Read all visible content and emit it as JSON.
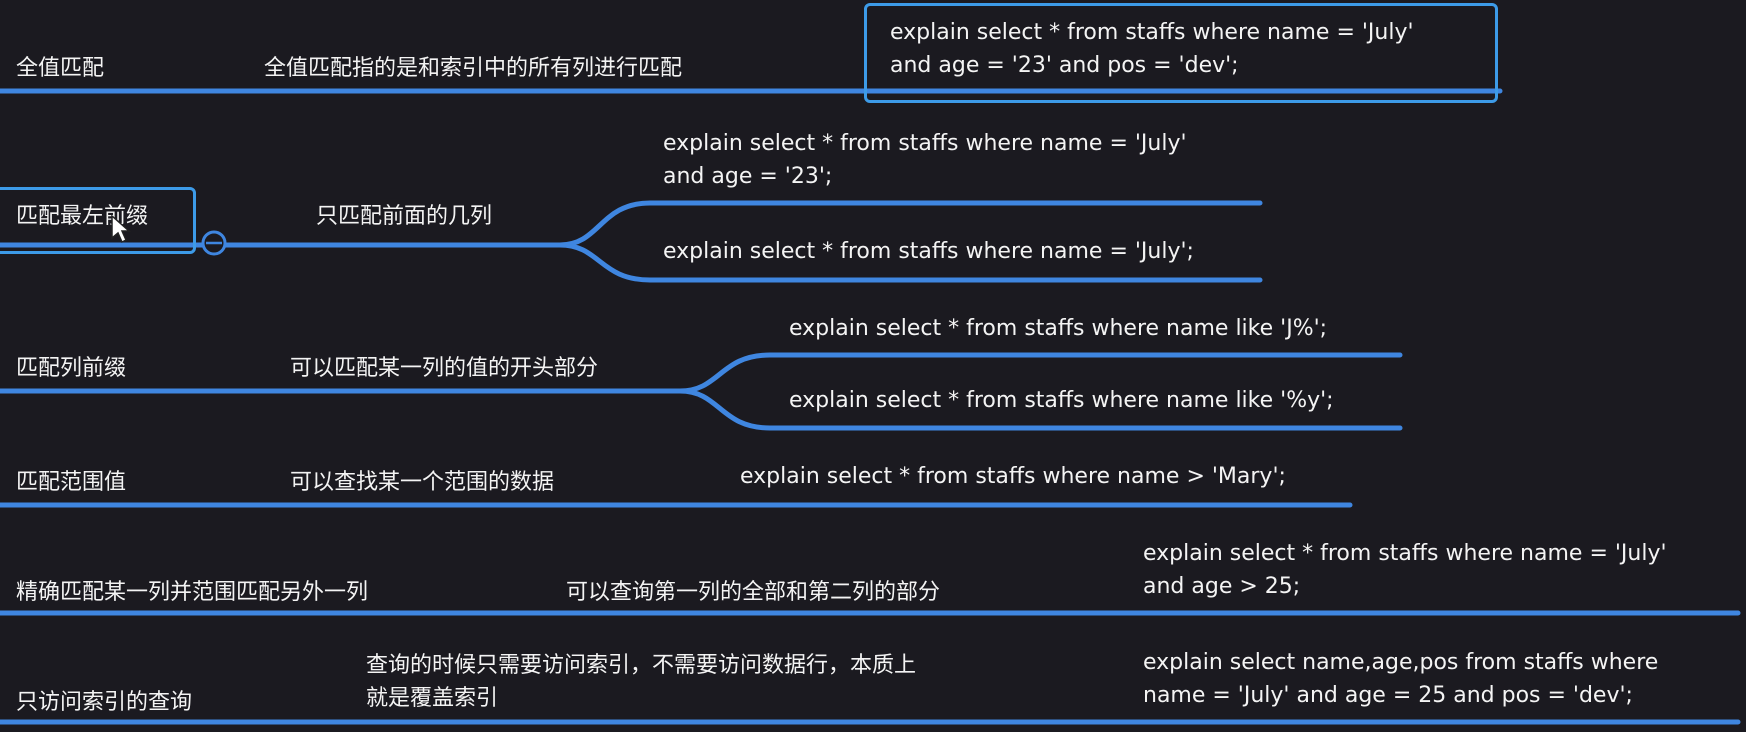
{
  "rows": [
    {
      "category": "全值匹配",
      "description": "全值匹配指的是和索引中的所有列进行匹配",
      "queries": [
        "explain select * from staffs where name = 'July' and age = '23' and pos = 'dev';"
      ]
    },
    {
      "category": "匹配最左前缀",
      "description": "只匹配前面的几列",
      "queries": [
        "explain select * from staffs where name = 'July' and age = '23';",
        "explain select * from staffs where name = 'July';"
      ]
    },
    {
      "category": "匹配列前缀",
      "description": "可以匹配某一列的值的开头部分",
      "queries": [
        "explain select * from staffs where name like 'J%';",
        "explain select * from staffs where name like '%y';"
      ]
    },
    {
      "category": "匹配范围值",
      "description": "可以查找某一个范围的数据",
      "queries": [
        "explain select * from staffs where name > 'Mary';"
      ]
    },
    {
      "category": "精确匹配某一列并范围匹配另外一列",
      "description": "可以查询第一列的全部和第二列的部分",
      "queries": [
        "explain select * from staffs where name = 'July' and age > 25;"
      ]
    },
    {
      "category": "只访问索引的查询",
      "description": "查询的时候只需要访问索引，不需要访问数据行，本质上就是覆盖索引",
      "queries": [
        "explain select name,age,pos from staffs where name = 'July' and age = 25 and pos = 'dev';"
      ]
    }
  ],
  "display": {
    "r0_q0_l1": "explain select * from staffs where name = 'July'",
    "r0_q0_l2": "and age = '23' and pos = 'dev';",
    "r1_q0_l1": "explain select * from staffs where name = 'July'",
    "r1_q0_l2": "and age = '23';",
    "r4_q0_l1": "explain select * from staffs where name = 'July'",
    "r4_q0_l2": "and age > 25;",
    "r5_desc_l1": "查询的时候只需要访问索引，不需要访问数据行，本质上",
    "r5_desc_l2": "就是覆盖索引",
    "r5_q0_l1": "explain select name,age,pos from staffs where",
    "r5_q0_l2": "name = 'July' and age = 25 and pos = 'dev';"
  },
  "colors": {
    "background": "#1b1a20",
    "line": "#3f86e0",
    "line_glow": "#5aa6ff",
    "selection_box": "#3d9be8",
    "text": "#f4f4f4"
  }
}
